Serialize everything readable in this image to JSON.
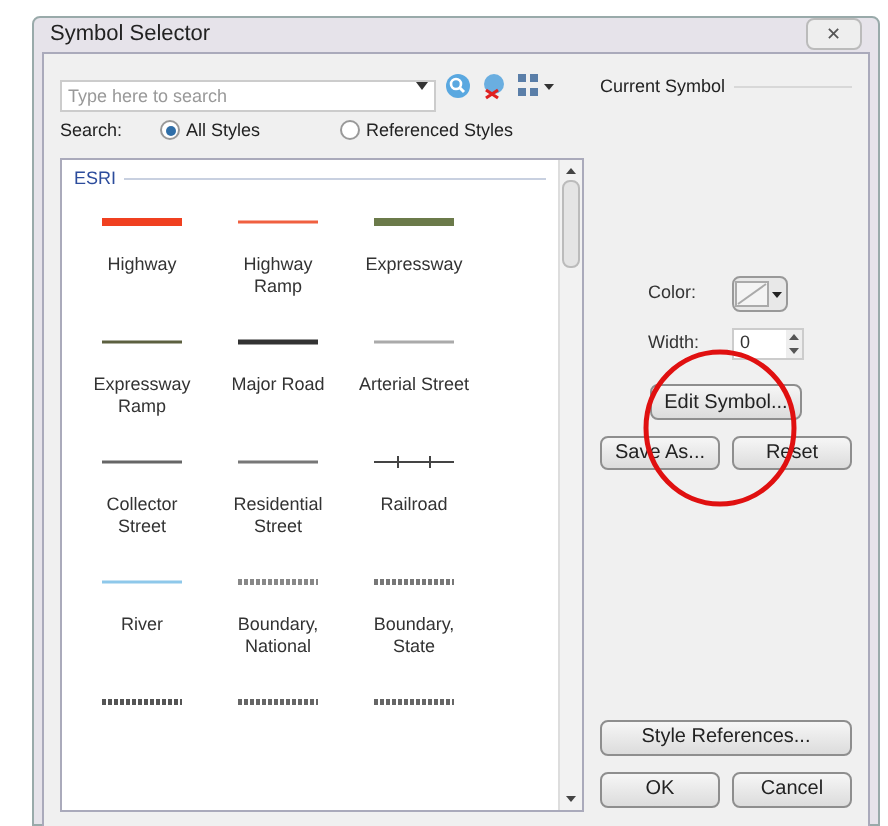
{
  "window": {
    "title": "Symbol Selector",
    "close": "✕"
  },
  "search": {
    "placeholder": "Type here to search"
  },
  "scope": {
    "label": "Search:",
    "options": [
      {
        "label": "All Styles",
        "selected": true
      },
      {
        "label": "Referenced Styles",
        "selected": false
      }
    ]
  },
  "group": "ESRI",
  "symbols": [
    {
      "label": "Highway",
      "color": "#f04020",
      "kind": "thick"
    },
    {
      "label": "Highway Ramp",
      "color": "#f06040",
      "kind": "thin"
    },
    {
      "label": "Expressway",
      "color": "#6b7a4a",
      "kind": "thick"
    },
    {
      "label": "Expressway Ramp",
      "color": "#5c6040",
      "kind": "thin"
    },
    {
      "label": "Major Road",
      "color": "#333333",
      "kind": "medium"
    },
    {
      "label": "Arterial Street",
      "color": "#aaaaaa",
      "kind": "thin"
    },
    {
      "label": "Collector Street",
      "color": "#666666",
      "kind": "thin"
    },
    {
      "label": "Residential Street",
      "color": "#777777",
      "kind": "thin"
    },
    {
      "label": "Railroad",
      "color": "#444444",
      "kind": "railroad"
    },
    {
      "label": "River",
      "color": "#8ec8ea",
      "kind": "thin"
    },
    {
      "label": "Boundary, National",
      "color": "#888888",
      "kind": "dashed"
    },
    {
      "label": "Boundary, State",
      "color": "#777777",
      "kind": "dashed"
    },
    {
      "color": "#555555",
      "kind": "dashed"
    },
    {
      "color": "#666666",
      "kind": "dashed"
    },
    {
      "color": "#666666",
      "kind": "dashed"
    }
  ],
  "current": {
    "title": "Current Symbol",
    "color_label": "Color:",
    "width_label": "Width:",
    "width_value": "0",
    "edit": "Edit Symbol...",
    "save": "Save As...",
    "reset": "Reset"
  },
  "style_references": "Style References...",
  "buttons": [
    "OK",
    "Cancel"
  ]
}
